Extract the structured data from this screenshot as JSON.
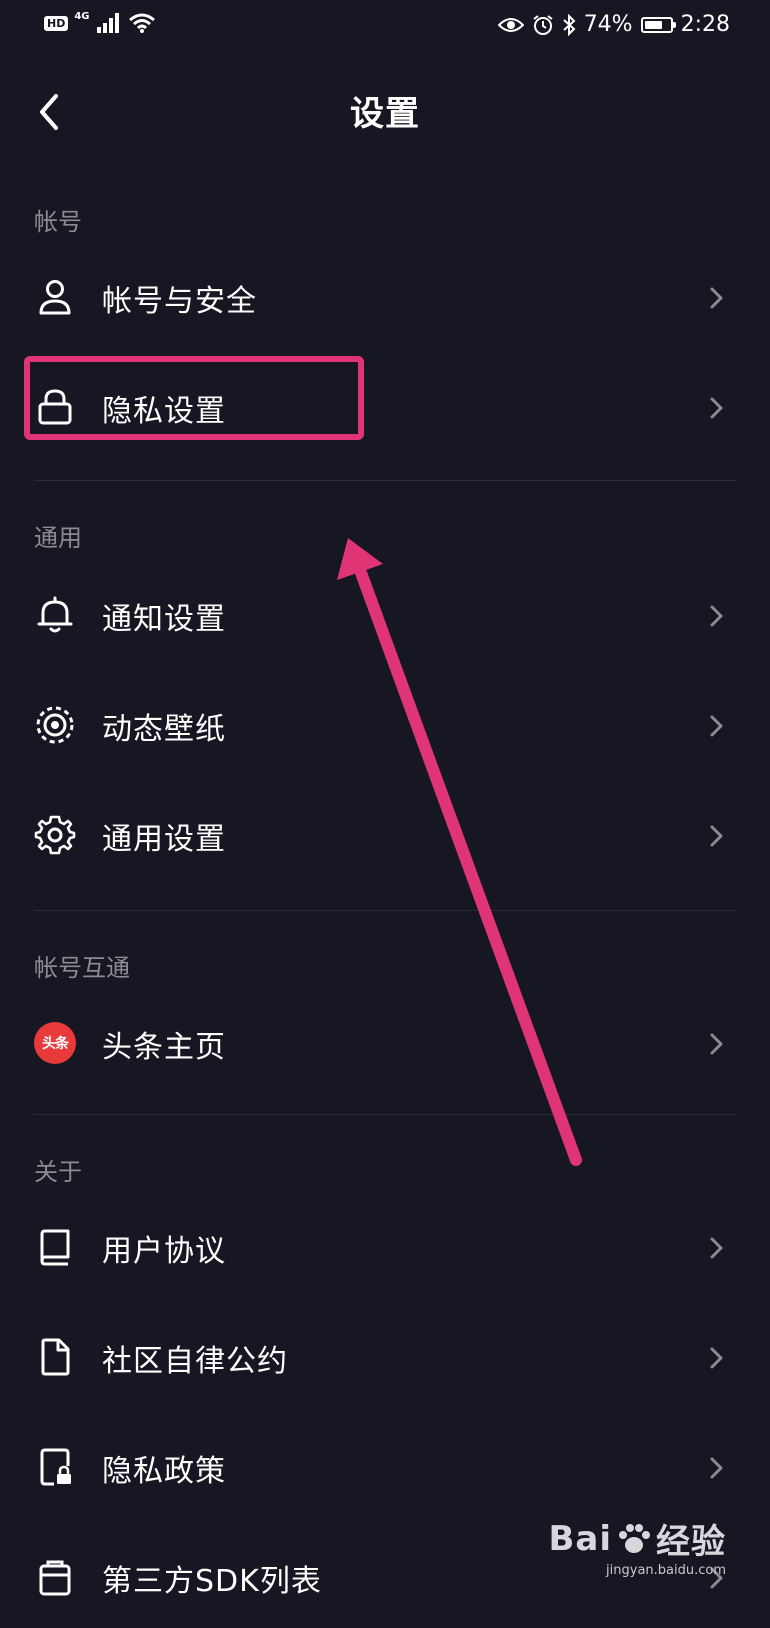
{
  "status_bar": {
    "hd": "HD",
    "network": "4G",
    "battery_text": "74%",
    "battery_level": 0.74,
    "time": "2:28"
  },
  "header": {
    "title": "设置"
  },
  "sections": [
    {
      "label": "帐号",
      "items": [
        {
          "label": "帐号与安全",
          "icon": "user-icon"
        },
        {
          "label": "隐私设置",
          "icon": "lock-icon"
        }
      ]
    },
    {
      "label": "通用",
      "items": [
        {
          "label": "通知设置",
          "icon": "bell-icon"
        },
        {
          "label": "动态壁纸",
          "icon": "wallpaper-icon"
        },
        {
          "label": "通用设置",
          "icon": "gear-icon"
        }
      ]
    },
    {
      "label": "帐号互通",
      "items": [
        {
          "label": "头条主页",
          "icon": "toutiao-icon",
          "icon_text": "头条"
        }
      ]
    },
    {
      "label": "关于",
      "items": [
        {
          "label": "用户协议",
          "icon": "book-icon"
        },
        {
          "label": "社区自律公约",
          "icon": "document-icon"
        },
        {
          "label": "隐私政策",
          "icon": "privacy-doc-icon"
        },
        {
          "label": "第三方SDK列表",
          "icon": "sdk-list-icon"
        }
      ]
    }
  ],
  "colors": {
    "background": "#161722",
    "annotation": "#e03574",
    "section_label": "#8a8b93",
    "toutiao_red": "#e83a3a"
  },
  "watermark": {
    "brand": "Bai",
    "brand2": "经验",
    "sub": "jingyan.baidu.com"
  }
}
